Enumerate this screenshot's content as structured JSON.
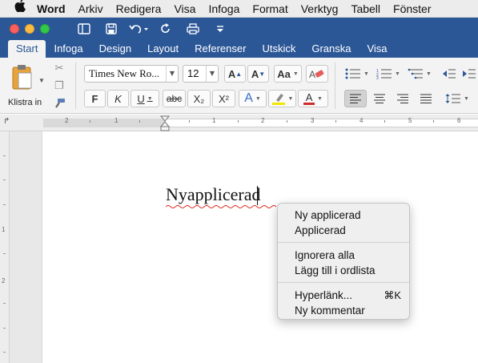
{
  "menubar": {
    "app_name": "Word",
    "items": [
      "Arkiv",
      "Redigera",
      "Visa",
      "Infoga",
      "Format",
      "Verktyg",
      "Tabell",
      "Fönster"
    ]
  },
  "quick_access": {
    "icons": [
      "sidebar-icon",
      "save-icon",
      "undo-icon",
      "redo-icon",
      "print-icon",
      "customize-icon"
    ]
  },
  "ribbon_tabs": [
    "Start",
    "Infoga",
    "Design",
    "Layout",
    "Referenser",
    "Utskick",
    "Granska",
    "Visa"
  ],
  "ribbon": {
    "paste_label": "Klistra in",
    "font_name": "Times New Ro...",
    "font_size": "12",
    "bold": "F",
    "italic": "K",
    "underline": "U",
    "strike": "abc",
    "subscript": "X₂",
    "superscript": "X²",
    "grow_font": "A",
    "shrink_font": "A",
    "change_case": "Aa",
    "font_color": "A",
    "text_effects": "A"
  },
  "ruler": {
    "corner": "↱",
    "numbers": [
      "2",
      "1",
      "1",
      "2",
      "3",
      "4",
      "5",
      "6"
    ],
    "left_numbers": [
      "1",
      "2"
    ]
  },
  "document": {
    "text": "Nyapplicerad"
  },
  "context_menu": {
    "suggestions": [
      "Ny applicerad",
      "Applicerad"
    ],
    "spelling": [
      "Ignorera alla",
      "Lägg till i ordlista"
    ],
    "hyperlink_label": "Hyperlänk...",
    "hyperlink_shortcut": "⌘K",
    "comment_label": "Ny kommentar"
  },
  "colors": {
    "ribbon_blue": "#2b5797",
    "close": "#fc605c",
    "minimize": "#fdbc40",
    "zoom": "#34c84a",
    "highlight": "#f2e500",
    "font_color": "#d12a2a",
    "spell_squiggle": "#e0241b"
  }
}
